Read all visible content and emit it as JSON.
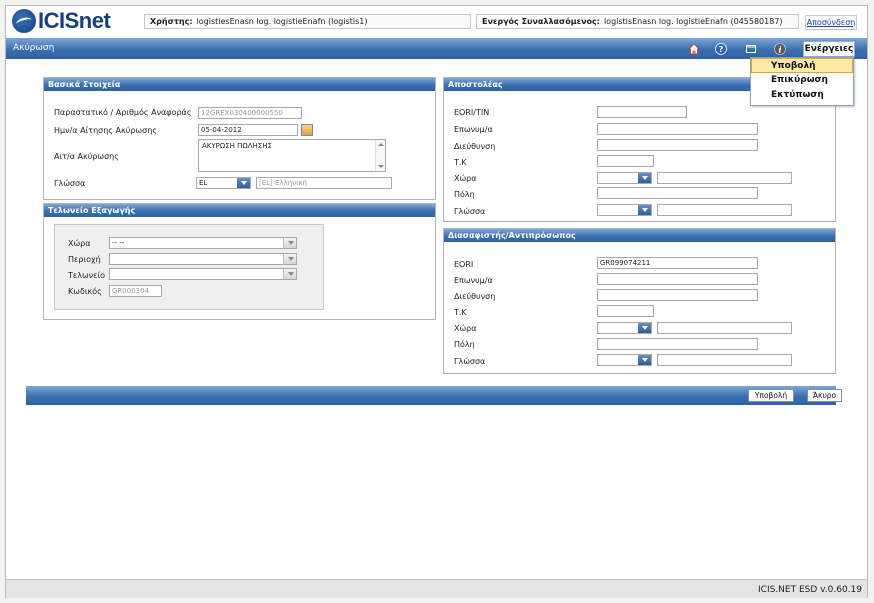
{
  "app": {
    "logo_text": "ICISnet"
  },
  "header": {
    "user_label": "Χρήστης:",
    "user_value": "logistiesEnasn log. logistieEnafn (logistis1)",
    "trader_label": "Ενεργός Συναλλασόμενος:",
    "trader_value": "logistisEnasn log. logistieEnafn (045580187)",
    "logout": "Αποσύνδεση"
  },
  "titlebar": {
    "title": "Ακύρωση",
    "actions_label": "Ενέργειες",
    "icons": [
      "home-icon",
      "help-icon",
      "window-icon",
      "info-icon"
    ]
  },
  "actions_menu": {
    "items": [
      "Υποβολή",
      "Επικύρωση",
      "Εκτύπωση"
    ],
    "highlighted": "Υποβολή"
  },
  "basic": {
    "header": "Βασικά Στοιχεία",
    "ref_label": "Παραστατικό / Αριθμός Αναφοράς",
    "ref_value": "12GREX030400000550",
    "date_label": "Ημν/α Αίτησης Ακύρωσης",
    "date_value": "05-04-2012",
    "reason_label": "Αιτ/α Ακύρωσης",
    "reason_value": "ΑΚΥΡΩΣΗ ΠΩΛΗΣΗΣ",
    "lang_label": "Γλώσσα",
    "lang_code": "EL",
    "lang_desc": "[EL] Ελληνική"
  },
  "customs": {
    "header": "Τελωνείο Εξαγωγής",
    "country_label": "Χώρα",
    "country_value": "-- --",
    "region_label": "Περιοχή",
    "office_label": "Τελωνείο",
    "code_label": "Κωδικός",
    "code_value": "GR000304"
  },
  "sender": {
    "header": "Αποστολέας",
    "eori_label": "EORI/TIN",
    "name_label": "Επωνυμ/α",
    "address_label": "Διεύθυνση",
    "zip_label": "Τ.Κ",
    "country_label": "Χώρα",
    "city_label": "Πόλη",
    "lang_label": "Γλώσσα"
  },
  "declarant": {
    "header": "Διασαφιστής/Αντιπρόσωπος",
    "eori_label": "EORI",
    "eori_value": "GR099074211",
    "name_label": "Επωνυμ/α",
    "address_label": "Διεύθυνση",
    "zip_label": "Τ.Κ",
    "country_label": "Χώρα",
    "city_label": "Πόλη",
    "lang_label": "Γλώσσα"
  },
  "bottom": {
    "submit": "Υποβολή",
    "cancel": "Άκυρο"
  },
  "footer": {
    "version": "ICIS.NET ESD v.0.60.19"
  }
}
